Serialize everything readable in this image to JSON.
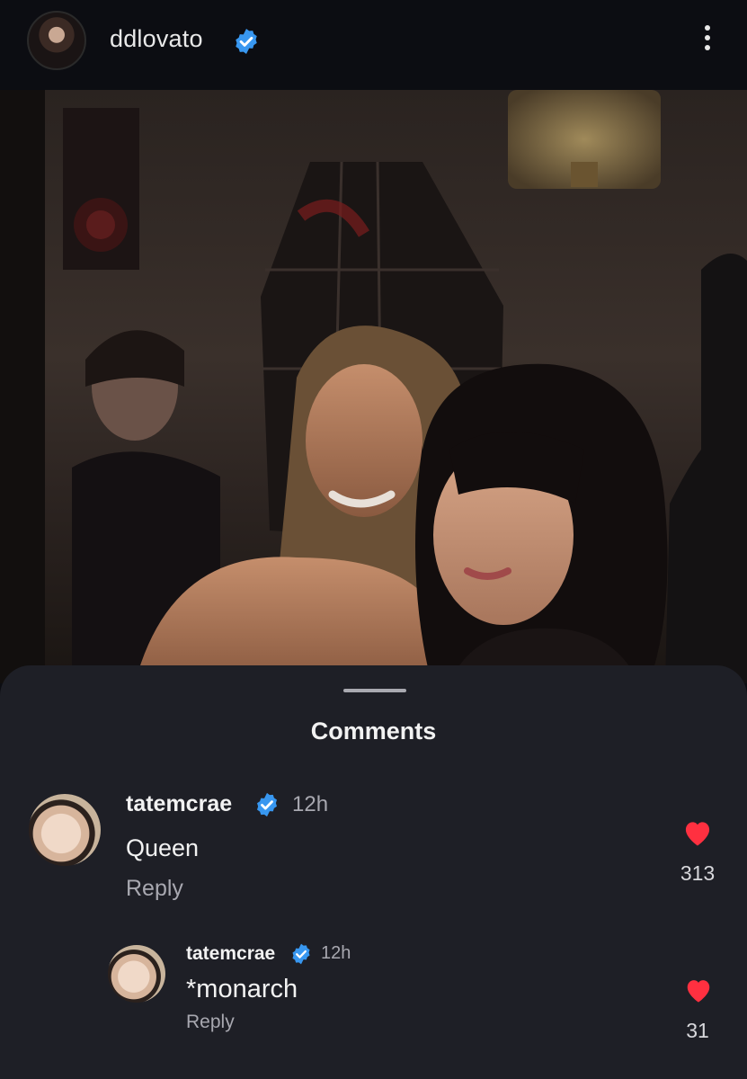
{
  "post": {
    "username": "ddlovato",
    "verified": true
  },
  "sheet": {
    "title": "Comments"
  },
  "comments": [
    {
      "username": "tatemcrae",
      "verified": true,
      "time": "12h",
      "text": "Queen",
      "reply_label": "Reply",
      "likes": "313"
    },
    {
      "username": "tatemcrae",
      "verified": true,
      "time": "12h",
      "text": "*monarch",
      "reply_label": "Reply",
      "likes": "31"
    }
  ],
  "colors": {
    "verified_badge": "#3897f0",
    "heart": "#ff3040",
    "background": "#0c0d12",
    "sheet": "#1e1f26"
  }
}
